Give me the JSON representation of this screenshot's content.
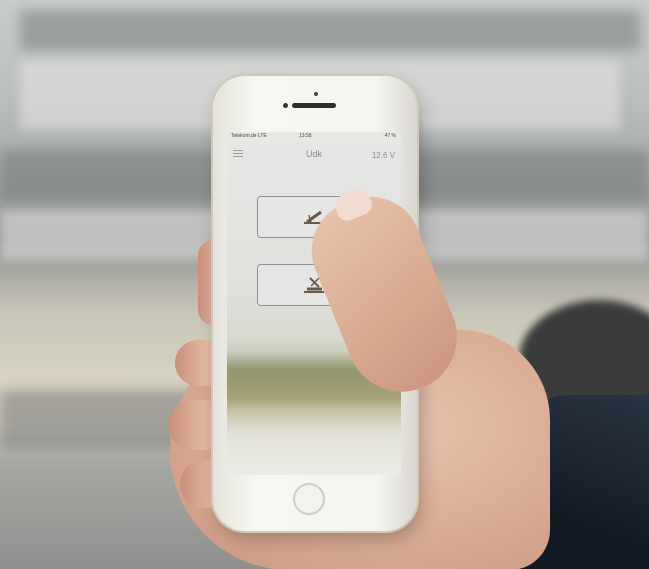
{
  "app": {
    "status": {
      "carrier": "Telekom.de  LTE",
      "time": "13:58",
      "battery": "47 %"
    },
    "header": {
      "title": "Udk",
      "voltage": "12.6 V"
    },
    "buttons": [
      {
        "icon": "tipper-raise-icon"
      },
      {
        "icon": "tipper-lower-icon"
      }
    ]
  }
}
